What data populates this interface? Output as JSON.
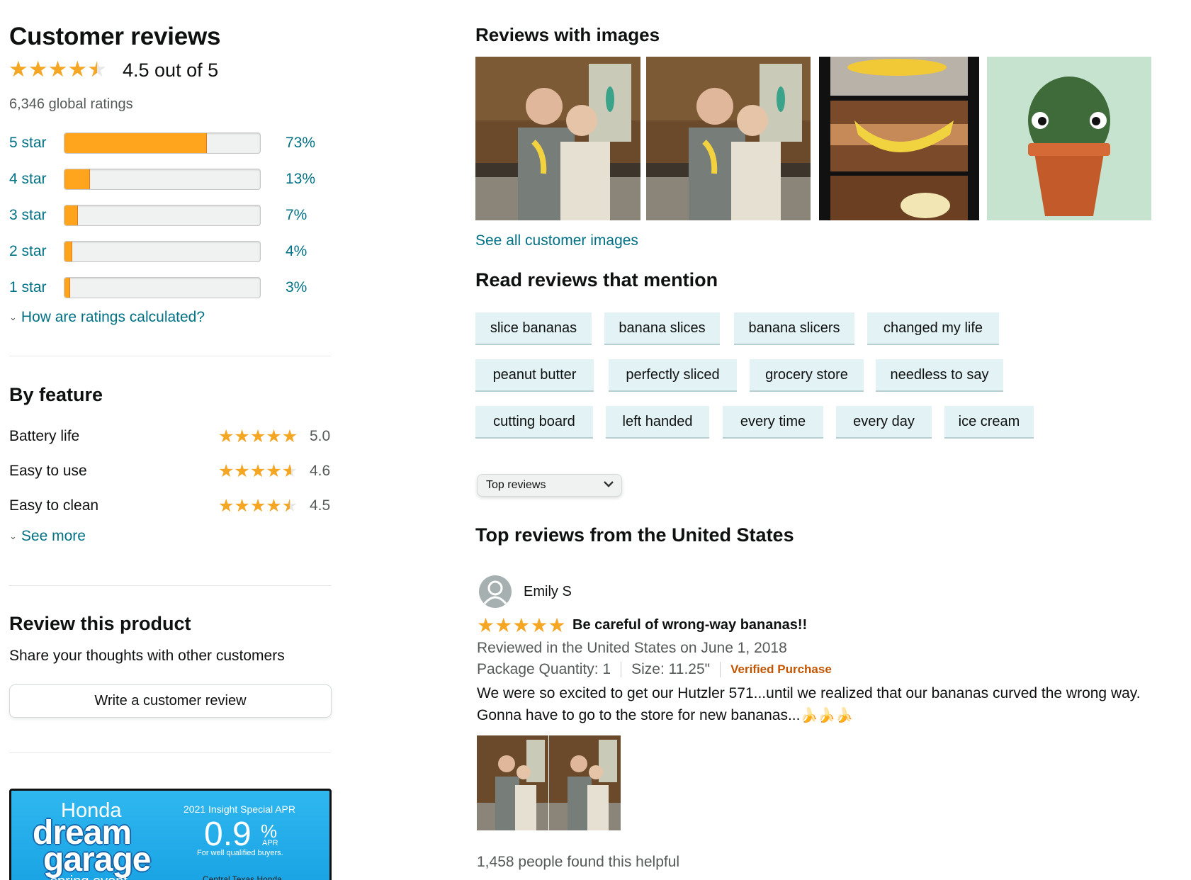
{
  "summary": {
    "title": "Customer reviews",
    "rating": 4.5,
    "rating_text": "4.5 out of 5",
    "global_ratings": "6,346 global ratings"
  },
  "histogram": [
    {
      "label": "5 star",
      "pct": 73,
      "pct_text": "73%"
    },
    {
      "label": "4 star",
      "pct": 13,
      "pct_text": "13%"
    },
    {
      "label": "3 star",
      "pct": 7,
      "pct_text": "7%"
    },
    {
      "label": "2 star",
      "pct": 4,
      "pct_text": "4%"
    },
    {
      "label": "1 star",
      "pct": 3,
      "pct_text": "3%"
    }
  ],
  "how_calculated": "How are ratings calculated?",
  "by_feature": {
    "title": "By feature",
    "items": [
      {
        "name": "Battery life",
        "rating": 5.0,
        "value": "5.0"
      },
      {
        "name": "Easy to use",
        "rating": 4.6,
        "value": "4.6"
      },
      {
        "name": "Easy to clean",
        "rating": 4.5,
        "value": "4.5"
      }
    ],
    "see_more": "See more"
  },
  "review_product": {
    "title": "Review this product",
    "subtitle": "Share your thoughts with other customers",
    "button": "Write a customer review"
  },
  "ad": {
    "brand": "Honda",
    "headline1": "dream",
    "headline2": "garage",
    "event": "spring event",
    "offer_title": "2021 Insight Special APR",
    "rate": "0.9",
    "percent": "%",
    "apr": "APR",
    "fine": "For well qualified buyers.",
    "dealer": "Central Texas Honda"
  },
  "images_section": {
    "title": "Reviews with images",
    "see_all": "See all customer images"
  },
  "mentions": {
    "title": "Read reviews that mention",
    "chips": [
      "slice bananas",
      "banana slices",
      "banana slicers",
      "changed my life",
      "peanut butter",
      "perfectly sliced",
      "grocery store",
      "needless to say",
      "cutting board",
      "left handed",
      "every time",
      "every day",
      "ice cream"
    ]
  },
  "sort": {
    "selected": "Top reviews"
  },
  "top_reviews": {
    "title": "Top reviews from the United States",
    "review": {
      "author": "Emily S",
      "rating": 5,
      "headline": "Be careful of wrong-way bananas!!",
      "date": "Reviewed in the United States on June 1, 2018",
      "package": "Package Quantity: 1",
      "size": "Size: 11.25\"",
      "verified": "Verified Purchase",
      "body_line1": "We were so excited to get our Hutzler 571...until we realized that our bananas curved the wrong way.",
      "body_line2": "Gonna have to go to the store for new bananas...",
      "emoji": "🍌🍌🍌",
      "helpful": "1,458 people found this helpful"
    }
  },
  "colors": {
    "star": "#f5a623",
    "link": "#007185",
    "bar_fill": "#ffa41c",
    "verified": "#c45500",
    "chip_bg": "#e3f2f4"
  }
}
